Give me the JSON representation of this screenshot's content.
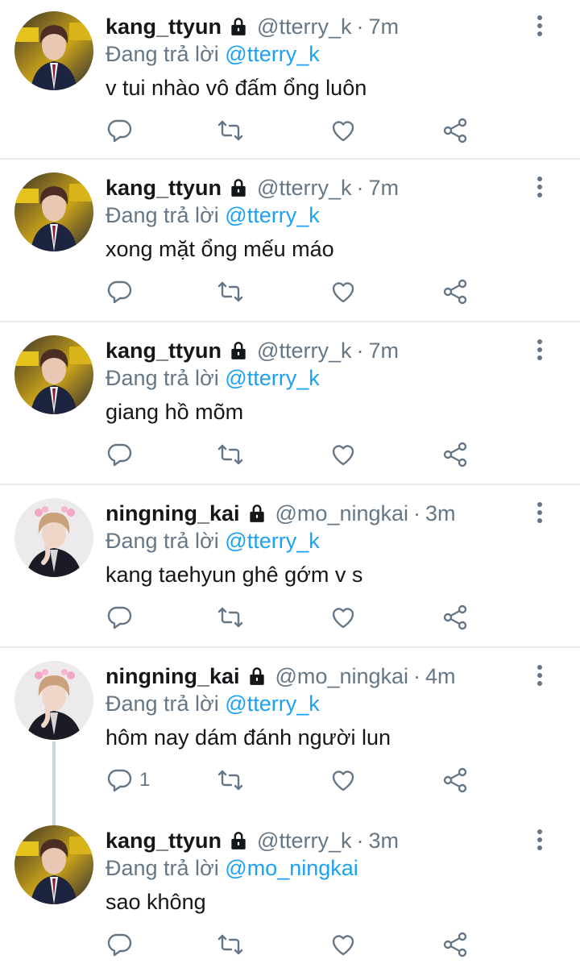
{
  "reply_prefix": "Đang trả lời",
  "colors": {
    "text": "#14171a",
    "secondary": "#657786",
    "link": "#1da1f2",
    "divider": "#e6ecf0",
    "thread_line": "#ccd6dd"
  },
  "icons": {
    "more": "more-vertical-icon",
    "lock": "lock-icon",
    "reply": "reply-icon",
    "retweet": "retweet-icon",
    "like": "heart-icon",
    "share": "share-icon"
  },
  "tweets": [
    {
      "name": "kang_ttyun",
      "handle": "@tterry_k",
      "time": "7m",
      "reply_to": "@tterry_k",
      "text": "v tui nhào vô đấm ổng luôn",
      "reply_count": ""
    },
    {
      "name": "kang_ttyun",
      "handle": "@tterry_k",
      "time": "7m",
      "reply_to": "@tterry_k",
      "text": "xong mặt ổng mếu máo",
      "reply_count": ""
    },
    {
      "name": "kang_ttyun",
      "handle": "@tterry_k",
      "time": "7m",
      "reply_to": "@tterry_k",
      "text": "giang hồ mõm",
      "reply_count": ""
    },
    {
      "name": "ningning_kai",
      "handle": "@mo_ningkai",
      "time": "3m",
      "reply_to": "@tterry_k",
      "text": "kang taehyun ghê gớm v s",
      "reply_count": ""
    },
    {
      "name": "ningning_kai",
      "handle": "@mo_ningkai",
      "time": "4m",
      "reply_to": "@tterry_k",
      "text": "hôm nay dám đánh người lun",
      "reply_count": "1"
    },
    {
      "name": "kang_ttyun",
      "handle": "@tterry_k",
      "time": "3m",
      "reply_to": "@mo_ningkai",
      "text": "sao không",
      "reply_count": ""
    }
  ]
}
